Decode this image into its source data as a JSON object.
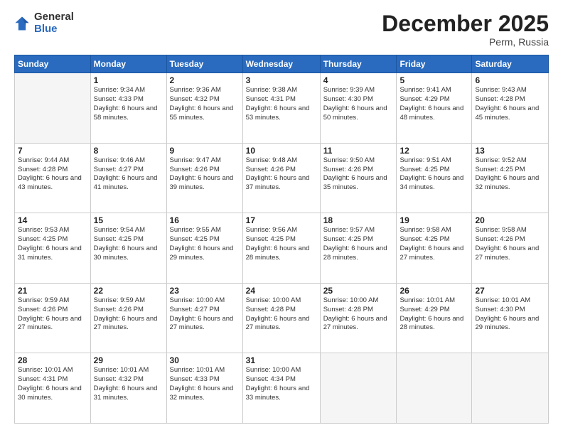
{
  "logo": {
    "general": "General",
    "blue": "Blue"
  },
  "title": "December 2025",
  "location": "Perm, Russia",
  "days_header": [
    "Sunday",
    "Monday",
    "Tuesday",
    "Wednesday",
    "Thursday",
    "Friday",
    "Saturday"
  ],
  "weeks": [
    [
      {
        "day": "",
        "info": ""
      },
      {
        "day": "1",
        "info": "Sunrise: 9:34 AM\nSunset: 4:33 PM\nDaylight: 6 hours\nand 58 minutes."
      },
      {
        "day": "2",
        "info": "Sunrise: 9:36 AM\nSunset: 4:32 PM\nDaylight: 6 hours\nand 55 minutes."
      },
      {
        "day": "3",
        "info": "Sunrise: 9:38 AM\nSunset: 4:31 PM\nDaylight: 6 hours\nand 53 minutes."
      },
      {
        "day": "4",
        "info": "Sunrise: 9:39 AM\nSunset: 4:30 PM\nDaylight: 6 hours\nand 50 minutes."
      },
      {
        "day": "5",
        "info": "Sunrise: 9:41 AM\nSunset: 4:29 PM\nDaylight: 6 hours\nand 48 minutes."
      },
      {
        "day": "6",
        "info": "Sunrise: 9:43 AM\nSunset: 4:28 PM\nDaylight: 6 hours\nand 45 minutes."
      }
    ],
    [
      {
        "day": "7",
        "info": "Sunrise: 9:44 AM\nSunset: 4:28 PM\nDaylight: 6 hours\nand 43 minutes."
      },
      {
        "day": "8",
        "info": "Sunrise: 9:46 AM\nSunset: 4:27 PM\nDaylight: 6 hours\nand 41 minutes."
      },
      {
        "day": "9",
        "info": "Sunrise: 9:47 AM\nSunset: 4:26 PM\nDaylight: 6 hours\nand 39 minutes."
      },
      {
        "day": "10",
        "info": "Sunrise: 9:48 AM\nSunset: 4:26 PM\nDaylight: 6 hours\nand 37 minutes."
      },
      {
        "day": "11",
        "info": "Sunrise: 9:50 AM\nSunset: 4:26 PM\nDaylight: 6 hours\nand 35 minutes."
      },
      {
        "day": "12",
        "info": "Sunrise: 9:51 AM\nSunset: 4:25 PM\nDaylight: 6 hours\nand 34 minutes."
      },
      {
        "day": "13",
        "info": "Sunrise: 9:52 AM\nSunset: 4:25 PM\nDaylight: 6 hours\nand 32 minutes."
      }
    ],
    [
      {
        "day": "14",
        "info": "Sunrise: 9:53 AM\nSunset: 4:25 PM\nDaylight: 6 hours\nand 31 minutes."
      },
      {
        "day": "15",
        "info": "Sunrise: 9:54 AM\nSunset: 4:25 PM\nDaylight: 6 hours\nand 30 minutes."
      },
      {
        "day": "16",
        "info": "Sunrise: 9:55 AM\nSunset: 4:25 PM\nDaylight: 6 hours\nand 29 minutes."
      },
      {
        "day": "17",
        "info": "Sunrise: 9:56 AM\nSunset: 4:25 PM\nDaylight: 6 hours\nand 28 minutes."
      },
      {
        "day": "18",
        "info": "Sunrise: 9:57 AM\nSunset: 4:25 PM\nDaylight: 6 hours\nand 28 minutes."
      },
      {
        "day": "19",
        "info": "Sunrise: 9:58 AM\nSunset: 4:25 PM\nDaylight: 6 hours\nand 27 minutes."
      },
      {
        "day": "20",
        "info": "Sunrise: 9:58 AM\nSunset: 4:26 PM\nDaylight: 6 hours\nand 27 minutes."
      }
    ],
    [
      {
        "day": "21",
        "info": "Sunrise: 9:59 AM\nSunset: 4:26 PM\nDaylight: 6 hours\nand 27 minutes."
      },
      {
        "day": "22",
        "info": "Sunrise: 9:59 AM\nSunset: 4:26 PM\nDaylight: 6 hours\nand 27 minutes."
      },
      {
        "day": "23",
        "info": "Sunrise: 10:00 AM\nSunset: 4:27 PM\nDaylight: 6 hours\nand 27 minutes."
      },
      {
        "day": "24",
        "info": "Sunrise: 10:00 AM\nSunset: 4:28 PM\nDaylight: 6 hours\nand 27 minutes."
      },
      {
        "day": "25",
        "info": "Sunrise: 10:00 AM\nSunset: 4:28 PM\nDaylight: 6 hours\nand 27 minutes."
      },
      {
        "day": "26",
        "info": "Sunrise: 10:01 AM\nSunset: 4:29 PM\nDaylight: 6 hours\nand 28 minutes."
      },
      {
        "day": "27",
        "info": "Sunrise: 10:01 AM\nSunset: 4:30 PM\nDaylight: 6 hours\nand 29 minutes."
      }
    ],
    [
      {
        "day": "28",
        "info": "Sunrise: 10:01 AM\nSunset: 4:31 PM\nDaylight: 6 hours\nand 30 minutes."
      },
      {
        "day": "29",
        "info": "Sunrise: 10:01 AM\nSunset: 4:32 PM\nDaylight: 6 hours\nand 31 minutes."
      },
      {
        "day": "30",
        "info": "Sunrise: 10:01 AM\nSunset: 4:33 PM\nDaylight: 6 hours\nand 32 minutes."
      },
      {
        "day": "31",
        "info": "Sunrise: 10:00 AM\nSunset: 4:34 PM\nDaylight: 6 hours\nand 33 minutes."
      },
      {
        "day": "",
        "info": ""
      },
      {
        "day": "",
        "info": ""
      },
      {
        "day": "",
        "info": ""
      }
    ]
  ]
}
